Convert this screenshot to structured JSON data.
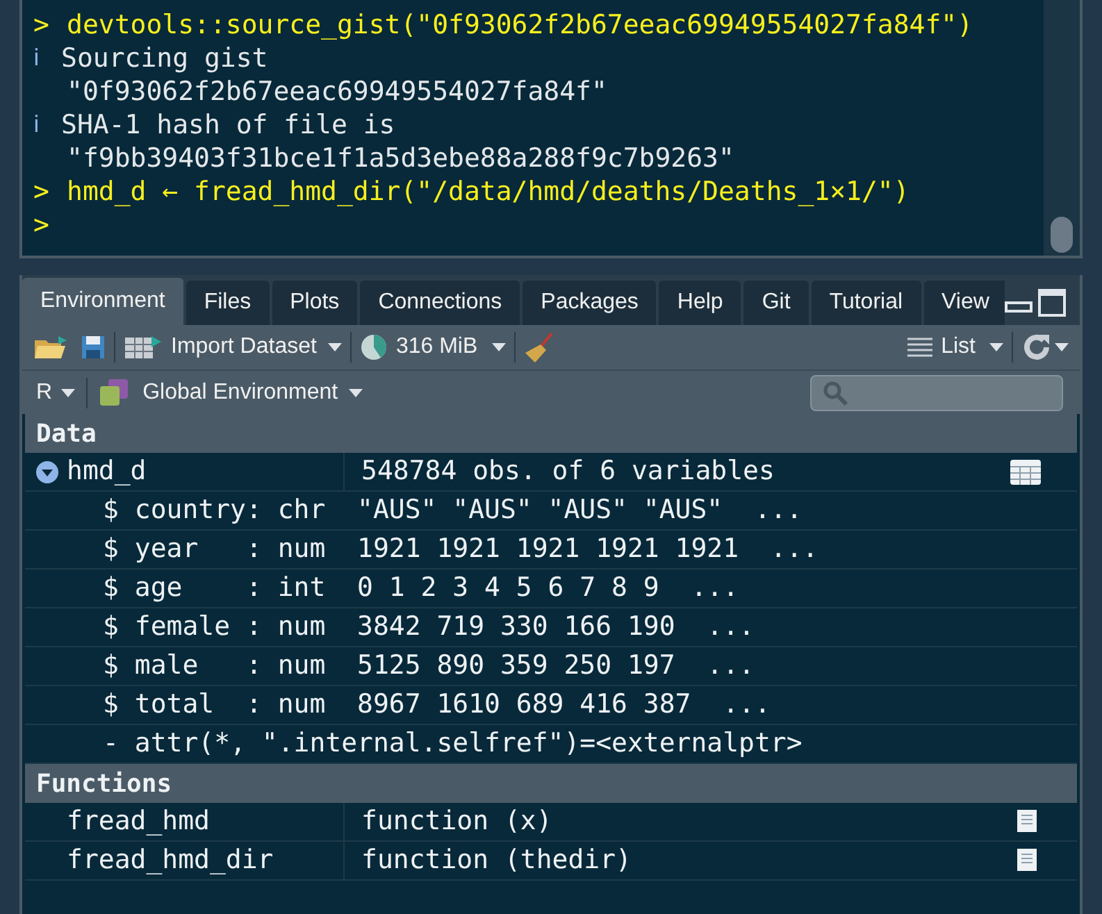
{
  "console": {
    "lines": [
      {
        "kind": "input",
        "prompt": ">",
        "text": "devtools::source_gist(\"0f93062f2b67eeac69949554027fa84f\")"
      },
      {
        "kind": "info",
        "marker": "ℹ",
        "text": "Sourcing gist"
      },
      {
        "kind": "output",
        "text": "\"0f93062f2b67eeac69949554027fa84f\""
      },
      {
        "kind": "info",
        "marker": "ℹ",
        "text": "SHA-1 hash of file is"
      },
      {
        "kind": "output",
        "text": "\"f9bb39403f31bce1f1a5d3ebe88a288f9c7b9263\""
      },
      {
        "kind": "input",
        "prompt": ">",
        "text": "hmd_d ← fread_hmd_dir(\"/data/hmd/deaths/Deaths_1×1/\")"
      },
      {
        "kind": "input",
        "prompt": ">"
      }
    ]
  },
  "tabs": [
    {
      "label": "Environment",
      "selected": true
    },
    {
      "label": "Files",
      "selected": false
    },
    {
      "label": "Plots",
      "selected": false
    },
    {
      "label": "Connections",
      "selected": false
    },
    {
      "label": "Packages",
      "selected": false
    },
    {
      "label": "Help",
      "selected": false
    },
    {
      "label": "Git",
      "selected": false
    },
    {
      "label": "Tutorial",
      "selected": false
    },
    {
      "label": "View",
      "selected": false
    }
  ],
  "toolbar": {
    "import_dataset": "Import Dataset",
    "memory": "316 MiB",
    "view_mode": "List"
  },
  "env_bar": {
    "language": "R",
    "environment": "Global Environment"
  },
  "sections": [
    {
      "title": "Data",
      "rows": [
        {
          "name": "hmd_d",
          "value": "548784 obs. of 6 variables",
          "expanded": true,
          "kind": "data",
          "children": [
            "$ country: chr  \"AUS\" \"AUS\" \"AUS\" \"AUS\"  ...",
            "$ year   : num  1921 1921 1921 1921 1921  ...",
            "$ age    : int  0 1 2 3 4 5 6 7 8 9  ...",
            "$ female : num  3842 719 330 166 190  ...",
            "$ male   : num  5125 890 359 250 197  ...",
            "$ total  : num  8967 1610 689 416 387  ...",
            "- attr(*, \".internal.selfref\")=<externalptr>"
          ]
        }
      ]
    },
    {
      "title": "Functions",
      "rows": [
        {
          "name": "fread_hmd",
          "value": "function (x)",
          "kind": "function"
        },
        {
          "name": "fread_hmd_dir",
          "value": "function (thedir)",
          "kind": "function"
        }
      ]
    }
  ]
}
